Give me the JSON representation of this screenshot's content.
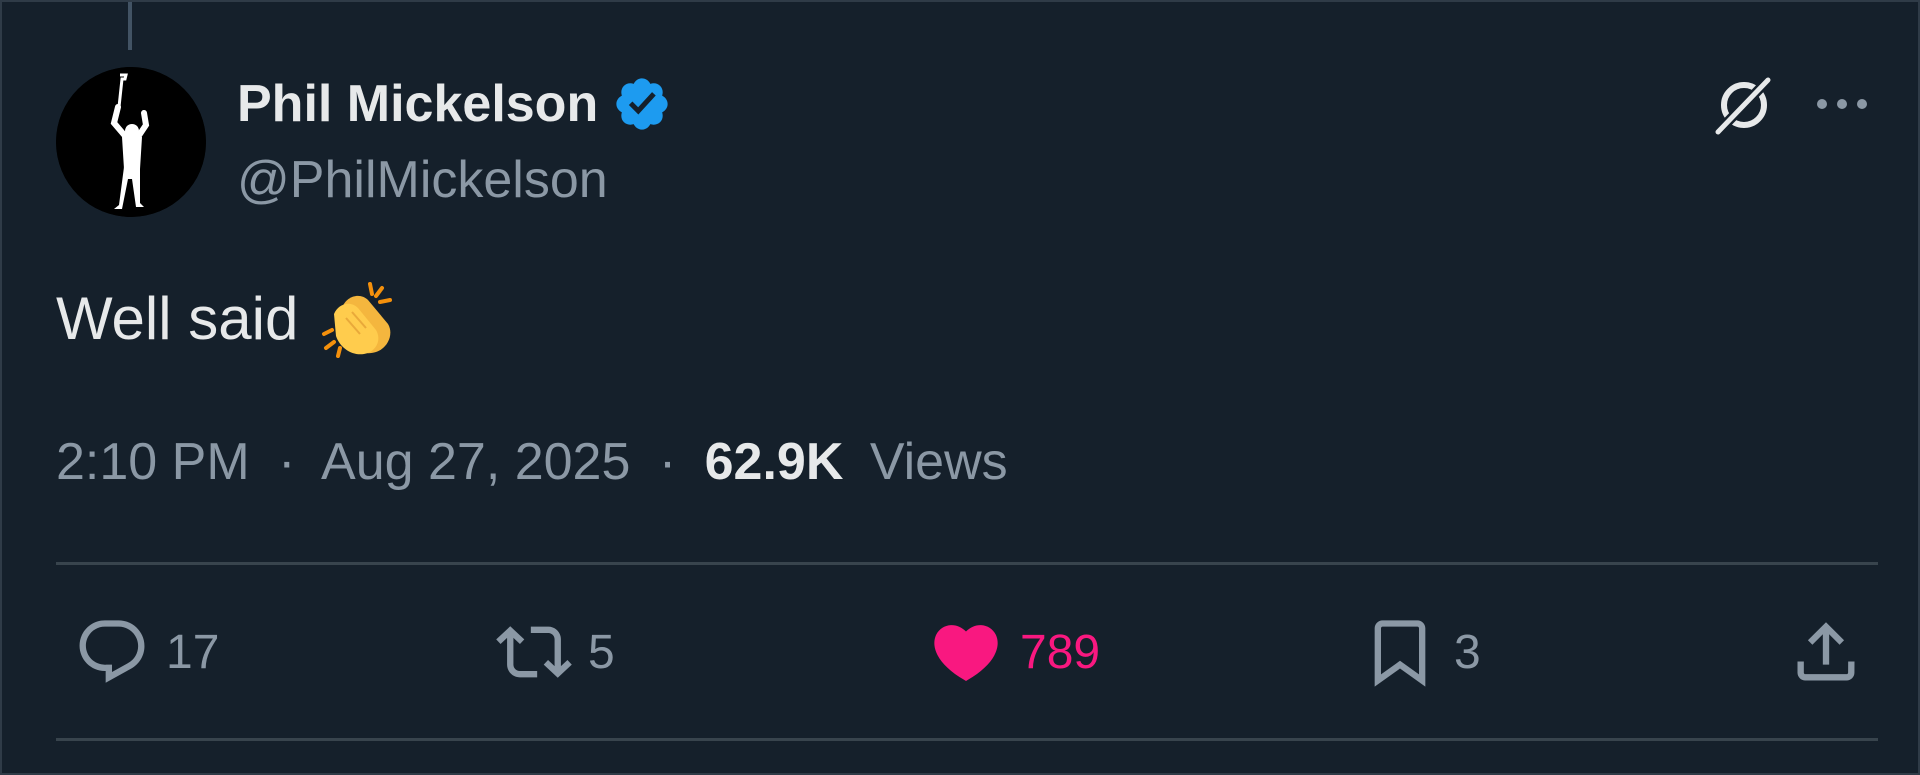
{
  "tweet": {
    "author": {
      "display_name": "Phil Mickelson",
      "handle": "@PhilMickelson",
      "verified": true
    },
    "text": "Well said",
    "emoji": "clapping-hands",
    "time": "2:10 PM",
    "date": "Aug 27, 2025",
    "separator": "·",
    "views_count": "62.9K",
    "views_label": "Views"
  },
  "actions": {
    "reply_count": "17",
    "retweet_count": "5",
    "like_count": "789",
    "bookmark_count": "3",
    "liked": true
  },
  "icons": {
    "verified": "verified-badge-icon",
    "grok": "grok-icon",
    "more": "more-icon",
    "reply": "reply-icon",
    "retweet": "retweet-icon",
    "like": "heart-icon",
    "bookmark": "bookmark-icon",
    "share": "share-icon"
  },
  "colors": {
    "background": "#15202b",
    "text_primary": "#e7e9ea",
    "text_secondary": "#8b98a5",
    "verified_blue": "#1d9bf0",
    "like_pink": "#f91880",
    "divider": "#38444d"
  }
}
